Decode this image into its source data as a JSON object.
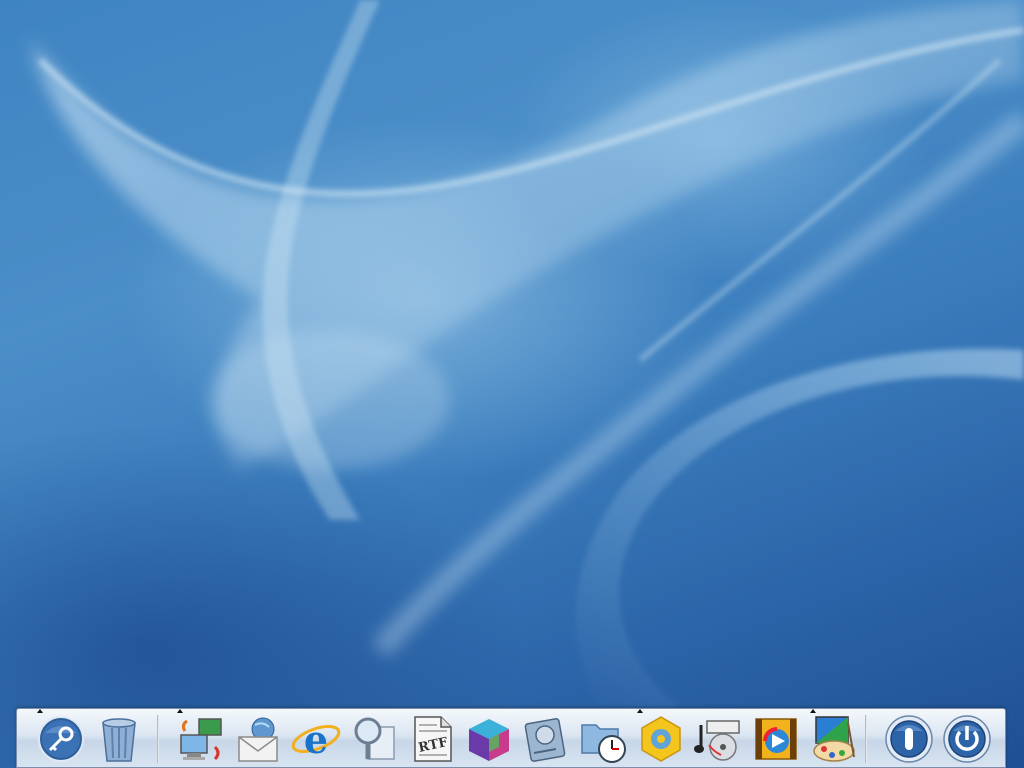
{
  "desktop": {
    "wallpaper": "blue-aqua-swirl",
    "colors": {
      "base": "#3f84c2",
      "highlight": "#a8d0ec",
      "shadow": "#1f4f93"
    }
  },
  "dock": {
    "groups": [
      {
        "name": "system",
        "items": [
          {
            "icon": "key-icon",
            "running": true
          },
          {
            "icon": "trash-icon",
            "running": false
          }
        ]
      },
      {
        "name": "applications",
        "items": [
          {
            "icon": "network-computers-icon",
            "running": true
          },
          {
            "icon": "mail-icon",
            "running": false
          },
          {
            "icon": "internet-explorer-icon",
            "running": false
          },
          {
            "icon": "search-magnifier-icon",
            "running": false
          },
          {
            "icon": "rtf-document-icon",
            "running": false
          },
          {
            "icon": "3d-cube-icon",
            "running": false
          },
          {
            "icon": "hard-drive-icon",
            "running": false
          },
          {
            "icon": "folder-clock-icon",
            "running": false
          },
          {
            "icon": "settings-gear-icon",
            "running": true
          },
          {
            "icon": "music-player-icon",
            "running": false
          },
          {
            "icon": "video-player-icon",
            "running": false
          },
          {
            "icon": "paint-palette-icon",
            "running": true
          }
        ]
      },
      {
        "name": "power",
        "items": [
          {
            "icon": "logout-power-icon",
            "running": false
          },
          {
            "icon": "shutdown-power-icon",
            "running": false
          }
        ]
      }
    ]
  }
}
